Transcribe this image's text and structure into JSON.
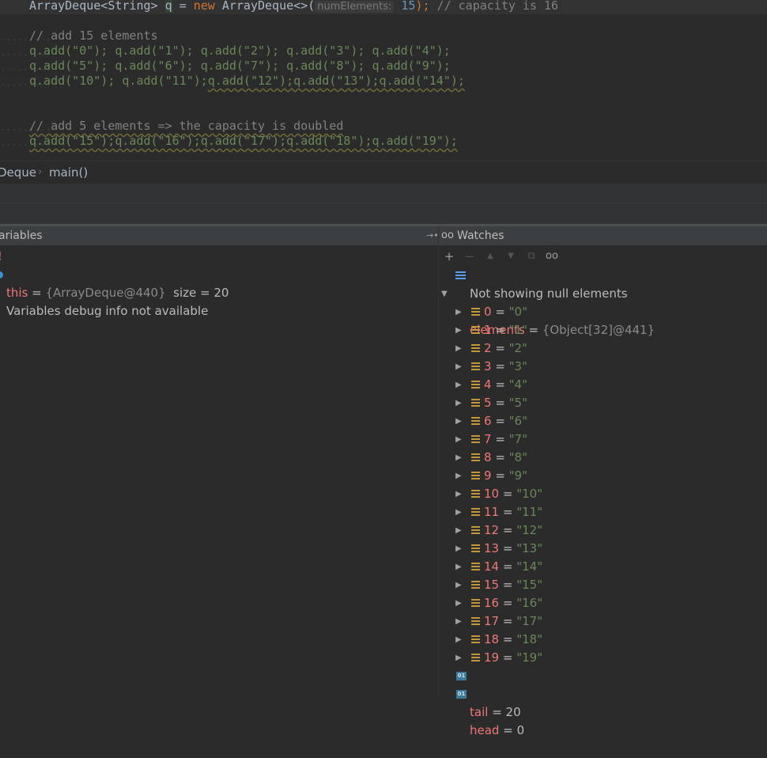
{
  "editor": {
    "l1_type": "ArrayDeque<String>",
    "l1_var": "q",
    "l1_eq": " = ",
    "l1_new": "new",
    "l1_ctor": " ArrayDeque<>(",
    "l1_hint": "numElements:",
    "l1_num": "15",
    "l1_end": ");",
    "l1_comment": " // capacity is 16",
    "l2_comment": "// add 15 elements",
    "l3": "q.add(\"0\"); q.add(\"1\"); q.add(\"2\"); q.add(\"3\"); q.add(\"4\");",
    "l4": "q.add(\"5\"); q.add(\"6\"); q.add(\"7\"); q.add(\"8\"); q.add(\"9\");",
    "l5a": "q.add(\"10\"); q.add(\"11\");",
    "l5b": "q.add(\"12\");q.add(\"13\");q.add(\"14\");",
    "l6_comment": "// add 5 elements => the capacity is doubled",
    "l7": "q.add(\"15\");q.add(\"16\");q.add(\"17\");q.add(\"18\");q.add(\"19\");"
  },
  "breadcrumb": {
    "class_name": "Deque",
    "method": "main()"
  },
  "panels": {
    "variables_title": "ariables",
    "watches_title": "Watches"
  },
  "variables": {
    "this_name": "this",
    "this_eq": " = ",
    "this_value": "{ArrayDeque@440}",
    "this_extra": "  size = 20",
    "info": "Variables debug info not available"
  },
  "watches": {
    "root_name": "elements",
    "root_value": "{Object[32]@441}",
    "note": "Not showing null elements",
    "items": [
      {
        "index": "0",
        "value": "\"0\""
      },
      {
        "index": "1",
        "value": "\"1\""
      },
      {
        "index": "2",
        "value": "\"2\""
      },
      {
        "index": "3",
        "value": "\"3\""
      },
      {
        "index": "4",
        "value": "\"4\""
      },
      {
        "index": "5",
        "value": "\"5\""
      },
      {
        "index": "6",
        "value": "\"6\""
      },
      {
        "index": "7",
        "value": "\"7\""
      },
      {
        "index": "8",
        "value": "\"8\""
      },
      {
        "index": "9",
        "value": "\"9\""
      },
      {
        "index": "10",
        "value": "\"10\""
      },
      {
        "index": "11",
        "value": "\"11\""
      },
      {
        "index": "12",
        "value": "\"12\""
      },
      {
        "index": "13",
        "value": "\"13\""
      },
      {
        "index": "14",
        "value": "\"14\""
      },
      {
        "index": "15",
        "value": "\"15\""
      },
      {
        "index": "16",
        "value": "\"16\""
      },
      {
        "index": "17",
        "value": "\"17\""
      },
      {
        "index": "18",
        "value": "\"18\""
      },
      {
        "index": "19",
        "value": "\"19\""
      }
    ],
    "tail_name": "tail",
    "tail_value": "20",
    "head_name": "head",
    "head_value": "0",
    "eq": " = "
  },
  "icons": {
    "primitive_label": "01"
  }
}
